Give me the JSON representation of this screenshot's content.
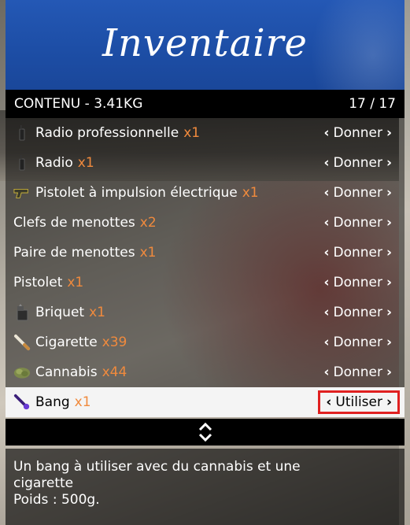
{
  "header": {
    "title": "Inventaire"
  },
  "subheader": {
    "left": "CONTENU - 3.41KG",
    "right": "17 / 17"
  },
  "items": [
    {
      "label": "Radio professionnelle",
      "qty": "x1",
      "icon": "radio-icon",
      "action": "Donner"
    },
    {
      "label": "Radio",
      "qty": "x1",
      "icon": "radio-icon",
      "action": "Donner"
    },
    {
      "label": "Pistolet à impulsion électrique",
      "qty": "x1",
      "icon": "stun-gun-icon",
      "action": "Donner"
    },
    {
      "label": "Clefs de menottes",
      "qty": "x2",
      "icon": "",
      "action": "Donner"
    },
    {
      "label": "Paire de menottes",
      "qty": "x1",
      "icon": "",
      "action": "Donner"
    },
    {
      "label": "Pistolet",
      "qty": "x1",
      "icon": "",
      "action": "Donner"
    },
    {
      "label": "Briquet",
      "qty": "x1",
      "icon": "lighter-icon",
      "action": "Donner"
    },
    {
      "label": "Cigarette",
      "qty": "x39",
      "icon": "cigarette-icon",
      "action": "Donner"
    },
    {
      "label": "Cannabis",
      "qty": "x44",
      "icon": "cannabis-icon",
      "action": "Donner"
    },
    {
      "label": "Bang",
      "qty": "x1",
      "icon": "bang-icon",
      "action": "Utiliser",
      "selected": true
    }
  ],
  "description": {
    "line1": "Un bang à utiliser avec du cannabis et une",
    "line2": "cigarette",
    "line3": "Poids : 500g."
  },
  "colors": {
    "header": "#1f4fa8",
    "qty": "#f08a3d",
    "highlight": "#e02020"
  }
}
